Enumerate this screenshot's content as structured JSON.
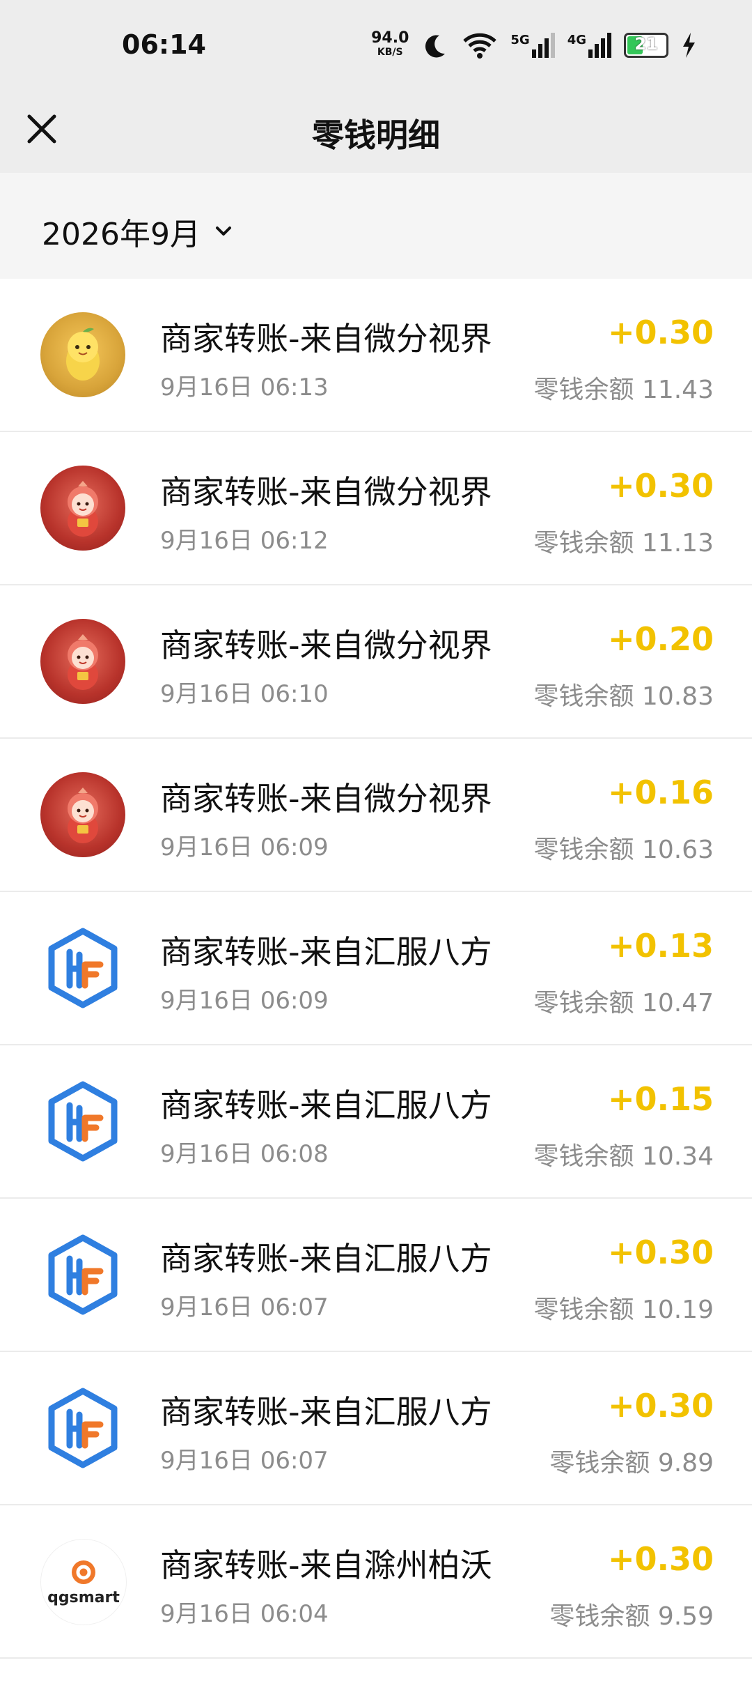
{
  "status_bar": {
    "time": "06:14",
    "net_speed": "94.0",
    "net_unit": "KB/S",
    "sig1": "5G",
    "sig2": "4G",
    "battery": "21"
  },
  "header": {
    "title": "零钱明细"
  },
  "filter": {
    "month": "2026年9月"
  },
  "transactions": [
    {
      "title": "商家转账-来自微分视界",
      "time": "9月16日 06:13",
      "amount": "+0.30",
      "balance": "零钱余额 11.43",
      "avatar": "lemon-mascot"
    },
    {
      "title": "商家转账-来自微分视界",
      "time": "9月16日 06:12",
      "amount": "+0.30",
      "balance": "零钱余额 11.13",
      "avatar": "pomegranate-mascot"
    },
    {
      "title": "商家转账-来自微分视界",
      "time": "9月16日 06:10",
      "amount": "+0.20",
      "balance": "零钱余额 10.83",
      "avatar": "pomegranate-mascot"
    },
    {
      "title": "商家转账-来自微分视界",
      "time": "9月16日 06:09",
      "amount": "+0.16",
      "balance": "零钱余额 10.63",
      "avatar": "pomegranate-mascot"
    },
    {
      "title": "商家转账-来自汇服八方",
      "time": "9月16日 06:09",
      "amount": "+0.13",
      "balance": "零钱余额 10.47",
      "avatar": "hf-logo"
    },
    {
      "title": "商家转账-来自汇服八方",
      "time": "9月16日 06:08",
      "amount": "+0.15",
      "balance": "零钱余额 10.34",
      "avatar": "hf-logo"
    },
    {
      "title": "商家转账-来自汇服八方",
      "time": "9月16日 06:07",
      "amount": "+0.30",
      "balance": "零钱余额 10.19",
      "avatar": "hf-logo"
    },
    {
      "title": "商家转账-来自汇服八方",
      "time": "9月16日 06:07",
      "amount": "+0.30",
      "balance": "零钱余额 9.89",
      "avatar": "hf-logo"
    },
    {
      "title": "商家转账-来自滁州柏沃",
      "time": "9月16日 06:04",
      "amount": "+0.30",
      "balance": "零钱余额 9.59",
      "avatar": "qgsmart-logo",
      "logo_text": "qgsmart"
    }
  ],
  "colors": {
    "amount": "#f2c200",
    "secondary": "#8c8c8c",
    "header_bg": "#ededed"
  }
}
